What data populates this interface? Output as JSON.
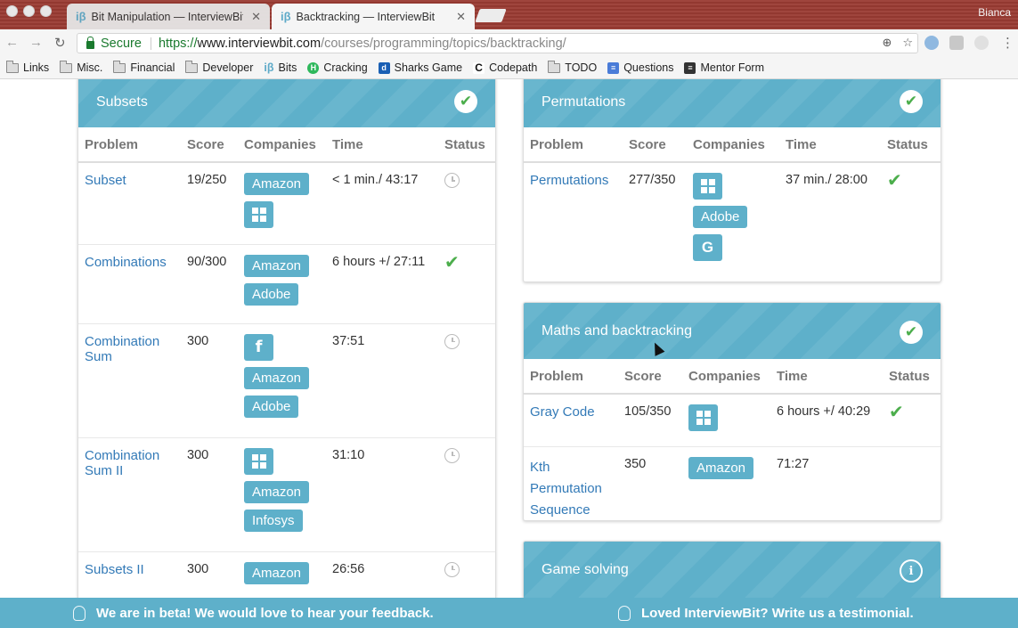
{
  "browser": {
    "tabs": [
      {
        "label": "Bit Manipulation — InterviewBit",
        "favicon": "iβ"
      },
      {
        "label": "Backtracking — InterviewBit",
        "favicon": "iβ"
      }
    ],
    "user": "Bianca",
    "secure_label": "Secure",
    "url_scheme": "https://",
    "url_domain": "www.interviewbit.com",
    "url_path": "/courses/programming/topics/backtracking/",
    "bookmarks": [
      {
        "label": "Links",
        "icon": "folder-icon"
      },
      {
        "label": "Misc.",
        "icon": "folder-icon"
      },
      {
        "label": "Financial",
        "icon": "folder-icon"
      },
      {
        "label": "Developer",
        "icon": "folder-icon"
      },
      {
        "label": "Bits",
        "icon": "ib-icon"
      },
      {
        "label": "Cracking",
        "icon": "h-icon"
      },
      {
        "label": "Sharks Game",
        "icon": "d-icon"
      },
      {
        "label": "Codepath",
        "icon": "c-icon"
      },
      {
        "label": "TODO",
        "icon": "folder-icon"
      },
      {
        "label": "Questions",
        "icon": "forms-icon"
      },
      {
        "label": "Mentor Form",
        "icon": "doc-icon"
      }
    ]
  },
  "columns": {
    "problem": "Problem",
    "score": "Score",
    "companies": "Companies",
    "time": "Time",
    "status": "Status"
  },
  "subsets_card": {
    "title": "Subsets",
    "rows": [
      {
        "problem": "Subset",
        "score": "19/250",
        "companies": [
          "Amazon",
          "windows-icon"
        ],
        "time": "< 1 min./ 43:17",
        "status": "clock"
      },
      {
        "problem": "Combinations",
        "score": "90/300",
        "companies": [
          "Amazon",
          "Adobe"
        ],
        "time": "6 hours +/ 27:11",
        "status": "check"
      },
      {
        "problem": "Combination Sum",
        "score": "300",
        "companies": [
          "facebook-icon",
          "Amazon",
          "Adobe"
        ],
        "time": "37:51",
        "status": "clock"
      },
      {
        "problem": "Combination Sum II",
        "score": "300",
        "companies": [
          "windows-icon",
          "Amazon",
          "Infosys"
        ],
        "time": "31:10",
        "status": "clock"
      },
      {
        "problem": "Subsets II",
        "score": "300",
        "companies": [
          "Amazon"
        ],
        "time": "26:56",
        "status": "clock"
      }
    ]
  },
  "permutations_card": {
    "title": "Permutations",
    "rows": [
      {
        "problem": "Permutations",
        "score": "277/350",
        "companies": [
          "windows-icon",
          "Adobe",
          "google-icon"
        ],
        "time": "37 min./ 28:00",
        "status": "check"
      }
    ]
  },
  "maths_card": {
    "title": "Maths and backtracking",
    "rows": [
      {
        "problem": "Gray Code",
        "score": "105/350",
        "companies": [
          "windows-icon"
        ],
        "time": "6 hours +/ 40:29",
        "status": "check"
      },
      {
        "problem": "Kth Permutation Sequence",
        "score": "350",
        "companies": [
          "Amazon"
        ],
        "time": "71:27",
        "status": ""
      }
    ]
  },
  "game_card": {
    "title": "Game solving"
  },
  "footer": {
    "feedback": "We are in beta! We would love to hear your feedback.",
    "testimonial": "Loved InterviewBit? Write us a testimonial."
  },
  "colors": {
    "accent": "#5eb0ca",
    "link": "#337ab7",
    "success": "#4cae4c"
  }
}
